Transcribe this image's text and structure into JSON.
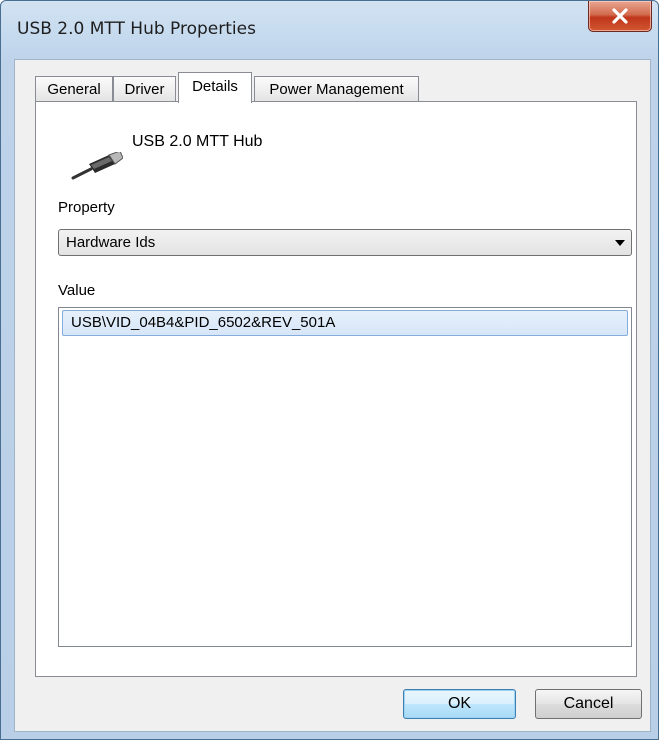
{
  "window": {
    "title": "USB 2.0 MTT Hub Properties"
  },
  "tabs": [
    {
      "label": "General"
    },
    {
      "label": "Driver"
    },
    {
      "label": "Details",
      "active": true
    },
    {
      "label": "Power Management"
    }
  ],
  "device": {
    "name": "USB 2.0 MTT Hub",
    "icon": "usb-plug-icon"
  },
  "property": {
    "label": "Property",
    "selected": "Hardware Ids"
  },
  "value": {
    "label": "Value",
    "items": [
      "USB\\VID_04B4&PID_6502&REV_501A"
    ]
  },
  "buttons": {
    "ok": "OK",
    "cancel": "Cancel"
  },
  "colors": {
    "close_button": "#c0361a",
    "selection": "#d7e6f8",
    "frame": "#bed3ea"
  }
}
